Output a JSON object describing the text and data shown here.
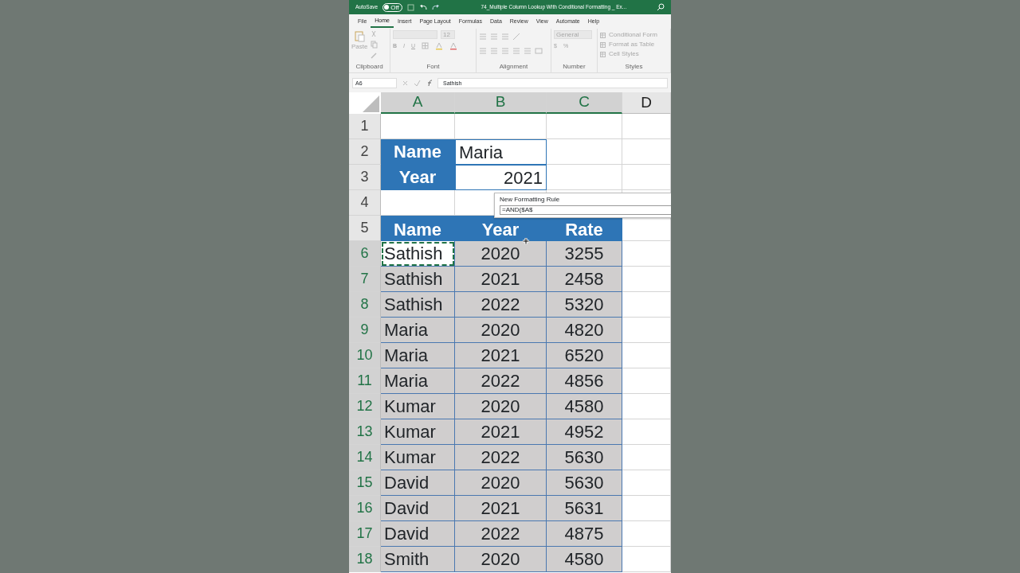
{
  "title_bar": {
    "autosave_label": "AutoSave",
    "autosave_on": false,
    "toggle_text": "Off",
    "title": "74_Multiple Column Lookup With Conditional Formatting _ Ex..."
  },
  "menu_tabs": [
    {
      "label": "File",
      "selected": false
    },
    {
      "label": "Home",
      "selected": true
    },
    {
      "label": "Insert",
      "selected": false
    },
    {
      "label": "Page Layout",
      "selected": false
    },
    {
      "label": "Formulas",
      "selected": false
    },
    {
      "label": "Data",
      "selected": false
    },
    {
      "label": "Review",
      "selected": false
    },
    {
      "label": "View",
      "selected": false
    },
    {
      "label": "Automate",
      "selected": false
    },
    {
      "label": "Help",
      "selected": false
    }
  ],
  "ribbon": {
    "disabled": true,
    "groups": [
      {
        "kind": "clipboard",
        "label": "Clipboard",
        "items": [
          "Paste"
        ]
      },
      {
        "kind": "font",
        "label": "Font",
        "items": [
          "12",
          "B",
          "I",
          "U"
        ]
      },
      {
        "kind": "alignment",
        "label": "Alignment"
      },
      {
        "kind": "number",
        "label": "Number",
        "items": [
          "General",
          "$",
          "%"
        ]
      },
      {
        "kind": "styles",
        "label": "Styles",
        "items": [
          "Conditional Form",
          "Format as Table",
          "Cell Styles"
        ]
      }
    ]
  },
  "formula_bar": {
    "name_box": "A6",
    "formula": "Sathish"
  },
  "columns": [
    {
      "label": "A",
      "selected": true
    },
    {
      "label": "B",
      "selected": true
    },
    {
      "label": "C",
      "selected": true
    },
    {
      "label": "D",
      "selected": false
    }
  ],
  "rows": [
    {
      "number": "1",
      "selected": false,
      "kind": "blank"
    },
    {
      "number": "2",
      "selected": false,
      "kind": "param",
      "label": "Name",
      "value": {
        "text": "Maria",
        "kind": "text"
      }
    },
    {
      "number": "3",
      "selected": false,
      "kind": "param",
      "label": "Year",
      "value": {
        "text": "2021",
        "kind": "number"
      }
    },
    {
      "number": "4",
      "selected": false,
      "kind": "blank"
    },
    {
      "number": "5",
      "selected": false,
      "kind": "header",
      "cells": [
        "Name",
        "Year",
        "Rate"
      ]
    },
    {
      "number": "6",
      "selected": true,
      "kind": "data",
      "cells": [
        {
          "text": "Sathish",
          "active": true
        },
        {
          "text": "2020",
          "active": false
        },
        {
          "text": "3255",
          "active": false
        }
      ]
    },
    {
      "number": "7",
      "selected": true,
      "kind": "data",
      "cells": [
        {
          "text": "Sathish",
          "active": false
        },
        {
          "text": "2021",
          "active": false
        },
        {
          "text": "2458",
          "active": false
        }
      ]
    },
    {
      "number": "8",
      "selected": true,
      "kind": "data",
      "cells": [
        {
          "text": "Sathish",
          "active": false
        },
        {
          "text": "2022",
          "active": false
        },
        {
          "text": "5320",
          "active": false
        }
      ]
    },
    {
      "number": "9",
      "selected": true,
      "kind": "data",
      "cells": [
        {
          "text": "Maria",
          "active": false
        },
        {
          "text": "2020",
          "active": false
        },
        {
          "text": "4820",
          "active": false
        }
      ]
    },
    {
      "number": "10",
      "selected": true,
      "kind": "data",
      "cells": [
        {
          "text": "Maria",
          "active": false
        },
        {
          "text": "2021",
          "active": false
        },
        {
          "text": "6520",
          "active": false
        }
      ]
    },
    {
      "number": "11",
      "selected": true,
      "kind": "data",
      "cells": [
        {
          "text": "Maria",
          "active": false
        },
        {
          "text": "2022",
          "active": false
        },
        {
          "text": "4856",
          "active": false
        }
      ]
    },
    {
      "number": "12",
      "selected": true,
      "kind": "data",
      "cells": [
        {
          "text": "Kumar",
          "active": false
        },
        {
          "text": "2020",
          "active": false
        },
        {
          "text": "4580",
          "active": false
        }
      ]
    },
    {
      "number": "13",
      "selected": true,
      "kind": "data",
      "cells": [
        {
          "text": "Kumar",
          "active": false
        },
        {
          "text": "2021",
          "active": false
        },
        {
          "text": "4952",
          "active": false
        }
      ]
    },
    {
      "number": "14",
      "selected": true,
      "kind": "data",
      "cells": [
        {
          "text": "Kumar",
          "active": false
        },
        {
          "text": "2022",
          "active": false
        },
        {
          "text": "5630",
          "active": false
        }
      ]
    },
    {
      "number": "15",
      "selected": true,
      "kind": "data",
      "cells": [
        {
          "text": "David",
          "active": false
        },
        {
          "text": "2020",
          "active": false
        },
        {
          "text": "5630",
          "active": false
        }
      ]
    },
    {
      "number": "16",
      "selected": true,
      "kind": "data",
      "cells": [
        {
          "text": "David",
          "active": false
        },
        {
          "text": "2021",
          "active": false
        },
        {
          "text": "5631",
          "active": false
        }
      ]
    },
    {
      "number": "17",
      "selected": true,
      "kind": "data",
      "cells": [
        {
          "text": "David",
          "active": false
        },
        {
          "text": "2022",
          "active": false
        },
        {
          "text": "4875",
          "active": false
        }
      ]
    },
    {
      "number": "18",
      "selected": true,
      "kind": "data",
      "cells": [
        {
          "text": "Smith",
          "active": false
        },
        {
          "text": "2020",
          "active": false
        },
        {
          "text": "4580",
          "active": false
        }
      ]
    }
  ],
  "dialog": {
    "title": "New Formatting Rule",
    "formula": "=AND($A$"
  }
}
